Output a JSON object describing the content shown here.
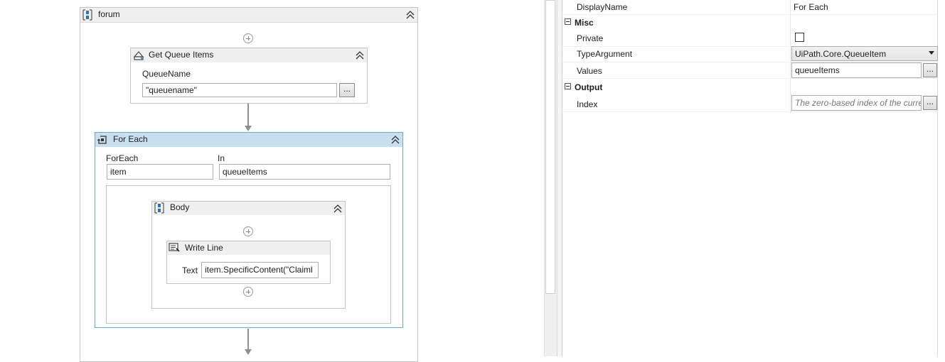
{
  "designer": {
    "sequence": {
      "title": "forum"
    },
    "get_queue_items": {
      "title": "Get Queue Items",
      "queue_name_label": "QueueName",
      "queue_name_value": "\"queuename\"",
      "browse_label": "..."
    },
    "for_each": {
      "title": "For Each",
      "foreach_label": "ForEach",
      "foreach_value": "item",
      "in_label": "In",
      "in_value": "queueItems"
    },
    "body": {
      "title": "Body"
    },
    "write_line": {
      "title": "Write Line",
      "text_label": "Text",
      "text_value": "item.SpecificContent(\"Claiml"
    }
  },
  "properties": {
    "display_name": {
      "name": "DisplayName",
      "value": "For Each"
    },
    "categories": {
      "misc": "Misc",
      "output": "Output"
    },
    "private": {
      "name": "Private",
      "checked": false
    },
    "type_argument": {
      "name": "TypeArgument",
      "value": "UiPath.Core.QueueItem"
    },
    "values": {
      "name": "Values",
      "value": "queueItems",
      "browse_label": "..."
    },
    "index": {
      "name": "Index",
      "placeholder": "The zero-based index of the curre",
      "browse_label": "..."
    }
  },
  "colors": {
    "selected_header": "#c8dff0",
    "selected_border": "#6fa8d2",
    "activity_border": "#c4c4c4",
    "header_bg": "#f0f0f0"
  }
}
